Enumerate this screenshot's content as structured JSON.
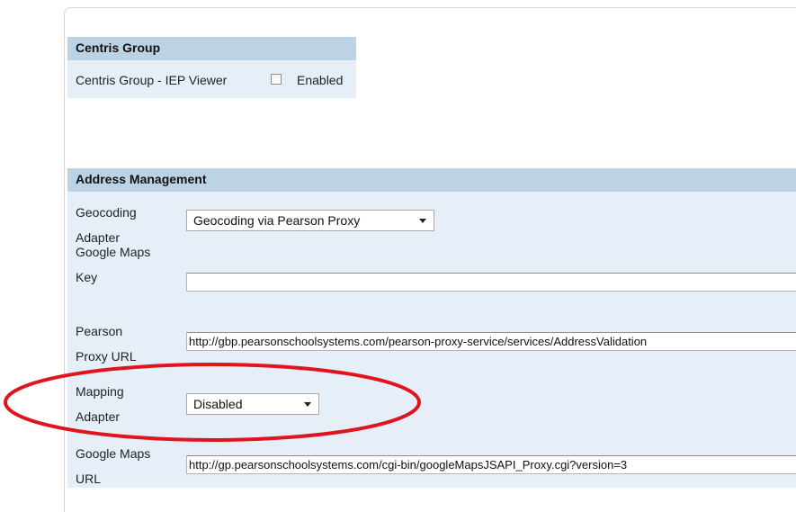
{
  "centris": {
    "header": "Centris Group",
    "row_label": "Centris Group - IEP Viewer",
    "checkbox_label": "Enabled",
    "checked": false
  },
  "address": {
    "header": "Address Management",
    "geocoding": {
      "label_line1": "Geocoding",
      "label_line2": "Adapter",
      "value": "Geocoding via Pearson Proxy"
    },
    "google_maps_key": {
      "label_line1": "Google Maps",
      "label_line2": "Key",
      "value": ""
    },
    "pearson_proxy": {
      "label_line1": "Pearson",
      "label_line2": "Proxy URL",
      "value": "http://gbp.pearsonschoolsystems.com/pearson-proxy-service/services/AddressValidation"
    },
    "mapping": {
      "label_line1": "Mapping",
      "label_line2": "Adapter",
      "value": "Disabled"
    },
    "google_maps_url": {
      "label_line1": "Google Maps",
      "label_line2": "URL",
      "value": "http://gp.pearsonschoolsystems.com/cgi-bin/googleMapsJSAPI_Proxy.cgi?version=3"
    }
  },
  "annotation": {
    "color": "#e0141e"
  }
}
